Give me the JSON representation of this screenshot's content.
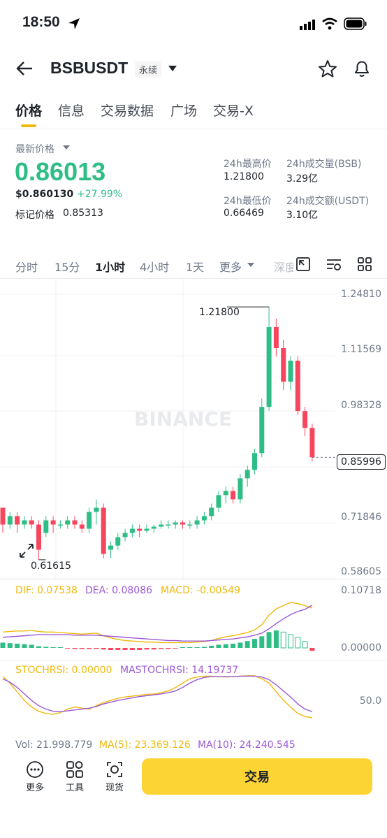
{
  "status": {
    "time": "18:50"
  },
  "header": {
    "symbol": "BSBUSDT",
    "tag": "永续"
  },
  "tabs": [
    {
      "label": "价格",
      "active": true
    },
    {
      "label": "信息",
      "active": false
    },
    {
      "label": "交易数据",
      "active": false
    },
    {
      "label": "广场",
      "active": false
    },
    {
      "label": "交易-X",
      "active": false
    }
  ],
  "market": {
    "last_price_label": "最新价格",
    "last_price": "0.86013",
    "usd_price": "$0.860130",
    "change": "+27.99%",
    "mark_label": "标记价格",
    "mark_price": "0.85313",
    "high_label": "24h最高价",
    "high": "1.21800",
    "vol_label": "24h成交量(BSB)",
    "vol": "3.29亿",
    "low_label": "24h最低价",
    "low": "0.66469",
    "turnover_label": "24h成交额(USDT)",
    "turnover": "3.10亿"
  },
  "intervals": [
    {
      "label": "分时",
      "active": false
    },
    {
      "label": "15分",
      "active": false
    },
    {
      "label": "1小时",
      "active": true
    },
    {
      "label": "4小时",
      "active": false
    },
    {
      "label": "1天",
      "active": false
    },
    {
      "label": "更多",
      "active": false
    },
    {
      "label": "深度",
      "active": false
    }
  ],
  "chart": {
    "watermark": "BINANCE",
    "price_axis": [
      "1.24810",
      "1.11569",
      "0.98328",
      "0.71846",
      "0.58605"
    ],
    "current_price": "0.85996",
    "high_marker": "1.21800",
    "low_marker": "0.61615",
    "macd_line": {
      "dif": "DIF: 0.07538",
      "dea": "DEA: 0.08086",
      "macd": "MACD: -0.00549"
    },
    "macd_axis": [
      "0.10718",
      "0.00000"
    ],
    "stoch_line": {
      "stoch": "STOCHRSI: 0.00000",
      "mastoch": "MASTOCHRSI: 14.19737"
    },
    "stoch_axis": [
      "50.0"
    ],
    "vol_line": {
      "vol": "Vol: 21.998.779",
      "ma5": "MA(5): 23.369.126",
      "ma10": "MA(10): 24.240.545"
    },
    "colors": {
      "up": "#2ebd85",
      "down": "#f6465d",
      "yellow": "#f0b90b",
      "purple": "#9b59d8"
    }
  },
  "chart_data": {
    "type": "candlestick",
    "ylim": [
      0.58605,
      1.2481
    ],
    "candles": [
      {
        "o": 0.74,
        "h": 0.74,
        "l": 0.68,
        "c": 0.7
      },
      {
        "o": 0.7,
        "h": 0.73,
        "l": 0.69,
        "c": 0.72
      },
      {
        "o": 0.72,
        "h": 0.73,
        "l": 0.68,
        "c": 0.7
      },
      {
        "o": 0.7,
        "h": 0.72,
        "l": 0.69,
        "c": 0.71
      },
      {
        "o": 0.71,
        "h": 0.72,
        "l": 0.69,
        "c": 0.7
      },
      {
        "o": 0.7,
        "h": 0.71,
        "l": 0.61615,
        "c": 0.64
      },
      {
        "o": 0.68,
        "h": 0.72,
        "l": 0.67,
        "c": 0.71
      },
      {
        "o": 0.71,
        "h": 0.72,
        "l": 0.68,
        "c": 0.7
      },
      {
        "o": 0.7,
        "h": 0.71,
        "l": 0.69,
        "c": 0.7
      },
      {
        "o": 0.7,
        "h": 0.72,
        "l": 0.69,
        "c": 0.71
      },
      {
        "o": 0.71,
        "h": 0.72,
        "l": 0.69,
        "c": 0.7
      },
      {
        "o": 0.7,
        "h": 0.71,
        "l": 0.68,
        "c": 0.69
      },
      {
        "o": 0.69,
        "h": 0.74,
        "l": 0.68,
        "c": 0.73
      },
      {
        "o": 0.73,
        "h": 0.76,
        "l": 0.7,
        "c": 0.74
      },
      {
        "o": 0.74,
        "h": 0.75,
        "l": 0.62,
        "c": 0.63
      },
      {
        "o": 0.64,
        "h": 0.66,
        "l": 0.62,
        "c": 0.65
      },
      {
        "o": 0.65,
        "h": 0.68,
        "l": 0.64,
        "c": 0.67
      },
      {
        "o": 0.67,
        "h": 0.69,
        "l": 0.66,
        "c": 0.68
      },
      {
        "o": 0.68,
        "h": 0.7,
        "l": 0.67,
        "c": 0.69
      },
      {
        "o": 0.69,
        "h": 0.7,
        "l": 0.67,
        "c": 0.685
      },
      {
        "o": 0.685,
        "h": 0.7,
        "l": 0.68,
        "c": 0.69
      },
      {
        "o": 0.69,
        "h": 0.7,
        "l": 0.68,
        "c": 0.695
      },
      {
        "o": 0.695,
        "h": 0.71,
        "l": 0.69,
        "c": 0.7
      },
      {
        "o": 0.7,
        "h": 0.71,
        "l": 0.69,
        "c": 0.7
      },
      {
        "o": 0.7,
        "h": 0.71,
        "l": 0.69,
        "c": 0.705
      },
      {
        "o": 0.705,
        "h": 0.71,
        "l": 0.69,
        "c": 0.7
      },
      {
        "o": 0.7,
        "h": 0.71,
        "l": 0.69,
        "c": 0.7
      },
      {
        "o": 0.7,
        "h": 0.72,
        "l": 0.69,
        "c": 0.71
      },
      {
        "o": 0.71,
        "h": 0.73,
        "l": 0.7,
        "c": 0.72
      },
      {
        "o": 0.72,
        "h": 0.75,
        "l": 0.71,
        "c": 0.74
      },
      {
        "o": 0.74,
        "h": 0.78,
        "l": 0.73,
        "c": 0.77
      },
      {
        "o": 0.77,
        "h": 0.79,
        "l": 0.75,
        "c": 0.78
      },
      {
        "o": 0.78,
        "h": 0.79,
        "l": 0.75,
        "c": 0.76
      },
      {
        "o": 0.76,
        "h": 0.82,
        "l": 0.75,
        "c": 0.81
      },
      {
        "o": 0.81,
        "h": 0.84,
        "l": 0.79,
        "c": 0.83
      },
      {
        "o": 0.83,
        "h": 0.88,
        "l": 0.82,
        "c": 0.87
      },
      {
        "o": 0.87,
        "h": 1.0,
        "l": 0.86,
        "c": 0.98
      },
      {
        "o": 0.98,
        "h": 1.218,
        "l": 0.97,
        "c": 1.17
      },
      {
        "o": 1.17,
        "h": 1.19,
        "l": 1.1,
        "c": 1.12
      },
      {
        "o": 1.12,
        "h": 1.14,
        "l": 1.02,
        "c": 1.04
      },
      {
        "o": 1.04,
        "h": 1.1,
        "l": 1.02,
        "c": 1.09
      },
      {
        "o": 1.09,
        "h": 1.1,
        "l": 0.96,
        "c": 0.97
      },
      {
        "o": 0.97,
        "h": 0.98,
        "l": 0.91,
        "c": 0.93
      },
      {
        "o": 0.93,
        "h": 0.94,
        "l": 0.85,
        "c": 0.85996
      }
    ],
    "macd_hist": [
      0.01,
      0.009,
      0.008,
      0.007,
      0.006,
      0.003,
      0.002,
      0.001,
      0.0,
      -0.001,
      -0.002,
      -0.002,
      -0.002,
      -0.002,
      -0.003,
      -0.004,
      -0.004,
      -0.004,
      -0.004,
      -0.004,
      -0.003,
      -0.003,
      -0.002,
      -0.002,
      -0.001,
      0.0,
      0.0,
      0.001,
      0.002,
      0.004,
      0.006,
      0.007,
      0.008,
      0.01,
      0.013,
      0.017,
      0.022,
      0.03,
      0.033,
      0.03,
      0.025,
      0.02,
      0.012,
      -0.00549
    ],
    "dif": [
      0.03,
      0.031,
      0.032,
      0.032,
      0.033,
      0.031,
      0.03,
      0.03,
      0.029,
      0.028,
      0.027,
      0.026,
      0.027,
      0.028,
      0.023,
      0.019,
      0.016,
      0.014,
      0.013,
      0.012,
      0.011,
      0.011,
      0.01,
      0.01,
      0.01,
      0.01,
      0.01,
      0.011,
      0.012,
      0.014,
      0.018,
      0.021,
      0.023,
      0.026,
      0.029,
      0.034,
      0.044,
      0.062,
      0.074,
      0.08,
      0.086,
      0.084,
      0.08,
      0.07538
    ],
    "dea": [
      0.02,
      0.021,
      0.022,
      0.023,
      0.024,
      0.025,
      0.025,
      0.025,
      0.025,
      0.025,
      0.024,
      0.024,
      0.024,
      0.024,
      0.023,
      0.022,
      0.021,
      0.02,
      0.019,
      0.018,
      0.017,
      0.016,
      0.015,
      0.014,
      0.014,
      0.013,
      0.013,
      0.013,
      0.013,
      0.014,
      0.015,
      0.016,
      0.017,
      0.019,
      0.021,
      0.024,
      0.028,
      0.036,
      0.046,
      0.055,
      0.063,
      0.069,
      0.073,
      0.08086
    ],
    "stochrsi": [
      95,
      80,
      60,
      40,
      25,
      15,
      10,
      8,
      12,
      20,
      25,
      22,
      20,
      28,
      35,
      40,
      45,
      48,
      50,
      52,
      54,
      55,
      58,
      62,
      70,
      80,
      90,
      94,
      96,
      96,
      95,
      94,
      95,
      96,
      97,
      97,
      90,
      80,
      60,
      40,
      25,
      10,
      3,
      0
    ],
    "mastochrsi": [
      90,
      82,
      70,
      55,
      40,
      28,
      20,
      15,
      14,
      16,
      18,
      20,
      22,
      26,
      32,
      36,
      40,
      43,
      46,
      49,
      51,
      53,
      55,
      58,
      62,
      70,
      80,
      88,
      93,
      95,
      95,
      95,
      95,
      96,
      96,
      96,
      94,
      88,
      76,
      62,
      48,
      32,
      20,
      14.19737
    ]
  },
  "bottom_bar": {
    "more": "更多",
    "tools": "工具",
    "spot": "现货",
    "trade": "交易"
  }
}
